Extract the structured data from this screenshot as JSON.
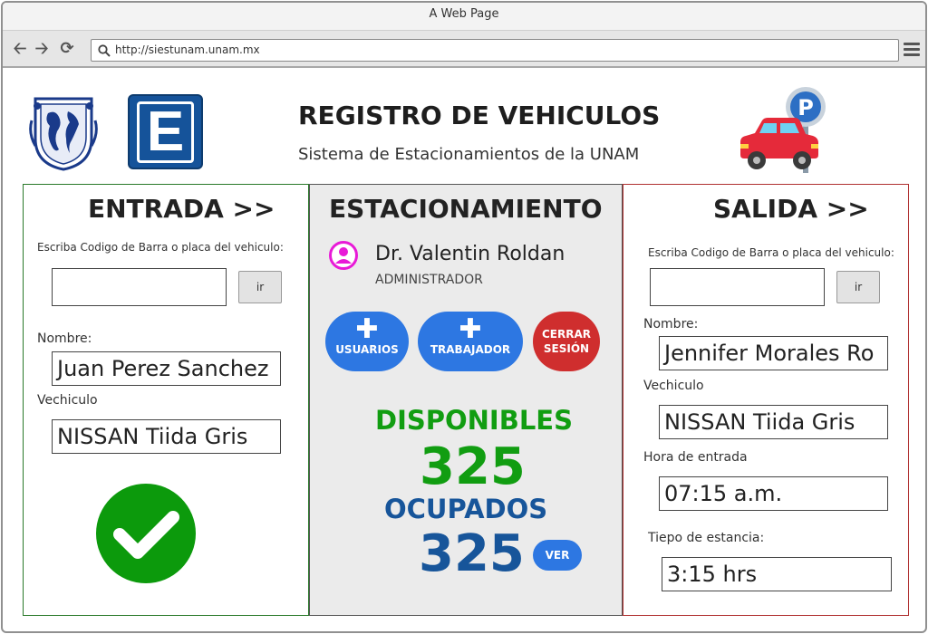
{
  "browser": {
    "window_title": "A Web Page",
    "url": "http://siestunam.unam.mx"
  },
  "header": {
    "title": "REGISTRO DE VEHICULOS",
    "subtitle": "Sistema de Estacionamientos de la UNAM",
    "parking_logo_letter": "E",
    "parking_sign_letter": "P"
  },
  "entrada": {
    "heading": "ENTRADA >>",
    "barcode_label": "Escriba Codigo de Barra o placa del vehiculo:",
    "barcode_value": "",
    "go_label": "ir",
    "nombre_label": "Nombre:",
    "nombre_value": "Juan Perez Sanchez",
    "vehiculo_label": "Vechiculo",
    "vehiculo_value": "NISSAN Tiida Gris",
    "status_icon": "check-icon"
  },
  "estacionamiento": {
    "heading": "ESTACIONAMIENTO",
    "user_name": "Dr. Valentin Roldan",
    "user_role": "ADMINISTRADOR",
    "btn_usuarios": "USUARIOS",
    "btn_trabajador": "TRABAJADOR",
    "btn_cerrar_1": "CERRAR",
    "btn_cerrar_2": "SESIÓN",
    "disponibles_label": "DISPONIBLES",
    "disponibles_value": "325",
    "ocupados_label": "OCUPADOS",
    "ocupados_value": "325",
    "btn_ver": "VER"
  },
  "salida": {
    "heading": "SALIDA >>",
    "barcode_label": "Escriba Codigo de Barra o placa del vehiculo:",
    "barcode_value": "",
    "go_label": "ir",
    "nombre_label": "Nombre:",
    "nombre_value": "Jennifer Morales Ro",
    "vehiculo_label": "Vechiculo",
    "vehiculo_value": "NISSAN Tiida Gris",
    "hora_label": "Hora de entrada",
    "hora_value": "07:15 a.m.",
    "estancia_label": "Tiepo de estancia:",
    "estancia_value": "3:15 hrs"
  },
  "colors": {
    "green": "#119d11",
    "blue": "#17559a",
    "button_blue": "#2d77e2",
    "button_red": "#cf2e2e"
  }
}
